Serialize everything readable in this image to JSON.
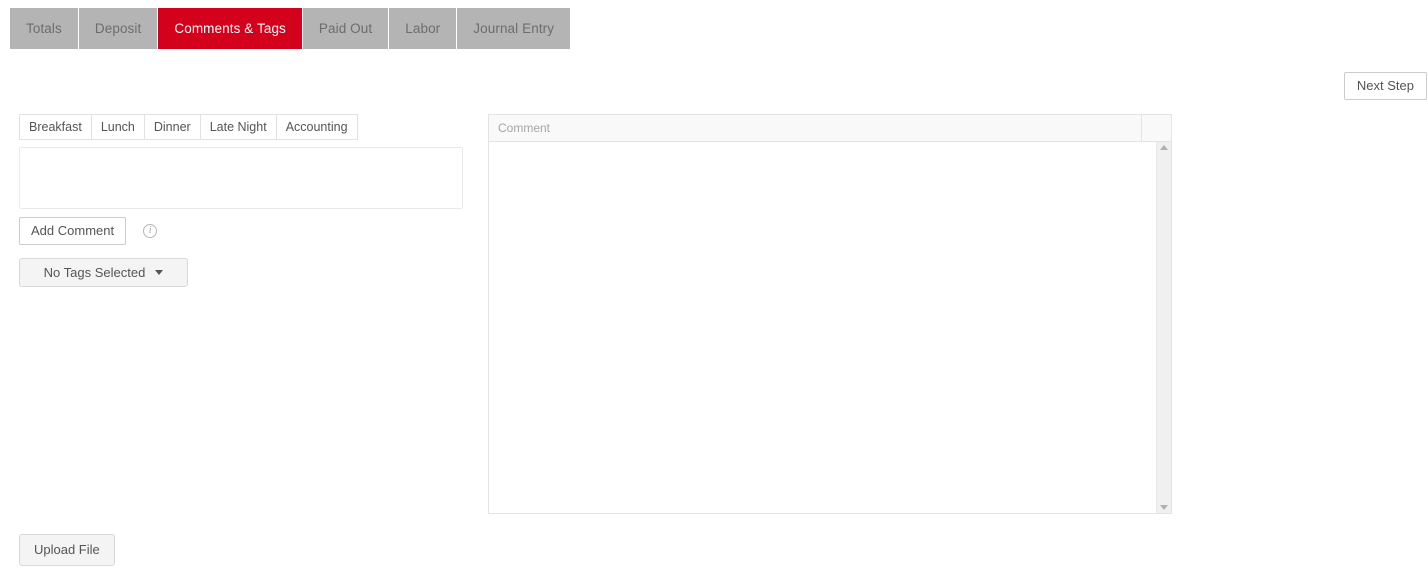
{
  "main_tabs": [
    {
      "label": "Totals",
      "active": false
    },
    {
      "label": "Deposit",
      "active": false
    },
    {
      "label": "Comments & Tags",
      "active": true
    },
    {
      "label": "Paid Out",
      "active": false
    },
    {
      "label": "Labor",
      "active": false
    },
    {
      "label": "Journal Entry",
      "active": false
    }
  ],
  "toolbar": {
    "next_step_label": "Next Step"
  },
  "left_panel": {
    "period_tabs": [
      {
        "label": "Breakfast"
      },
      {
        "label": "Lunch"
      },
      {
        "label": "Dinner"
      },
      {
        "label": "Late Night"
      },
      {
        "label": "Accounting"
      }
    ],
    "comment_input": {
      "value": "",
      "placeholder": ""
    },
    "add_comment_label": "Add Comment",
    "info_icon": "info-icon",
    "info_glyph": "i",
    "tags_dropdown": {
      "label": "No Tags Selected",
      "caret_icon": "chevron-down-icon"
    }
  },
  "comment_panel": {
    "columns": [
      {
        "label": "Comment"
      },
      {
        "label": ""
      }
    ],
    "rows": [],
    "scrollbar": {
      "up_icon": "scroll-up-arrow-icon",
      "down_icon": "scroll-down-arrow-icon"
    }
  },
  "footer": {
    "upload_label": "Upload File"
  },
  "colors": {
    "active_tab": "#d4011d",
    "inactive_tab": "#b4b4b4",
    "panel_border": "#e4e4e4",
    "button_face": "#f4f4f4"
  }
}
